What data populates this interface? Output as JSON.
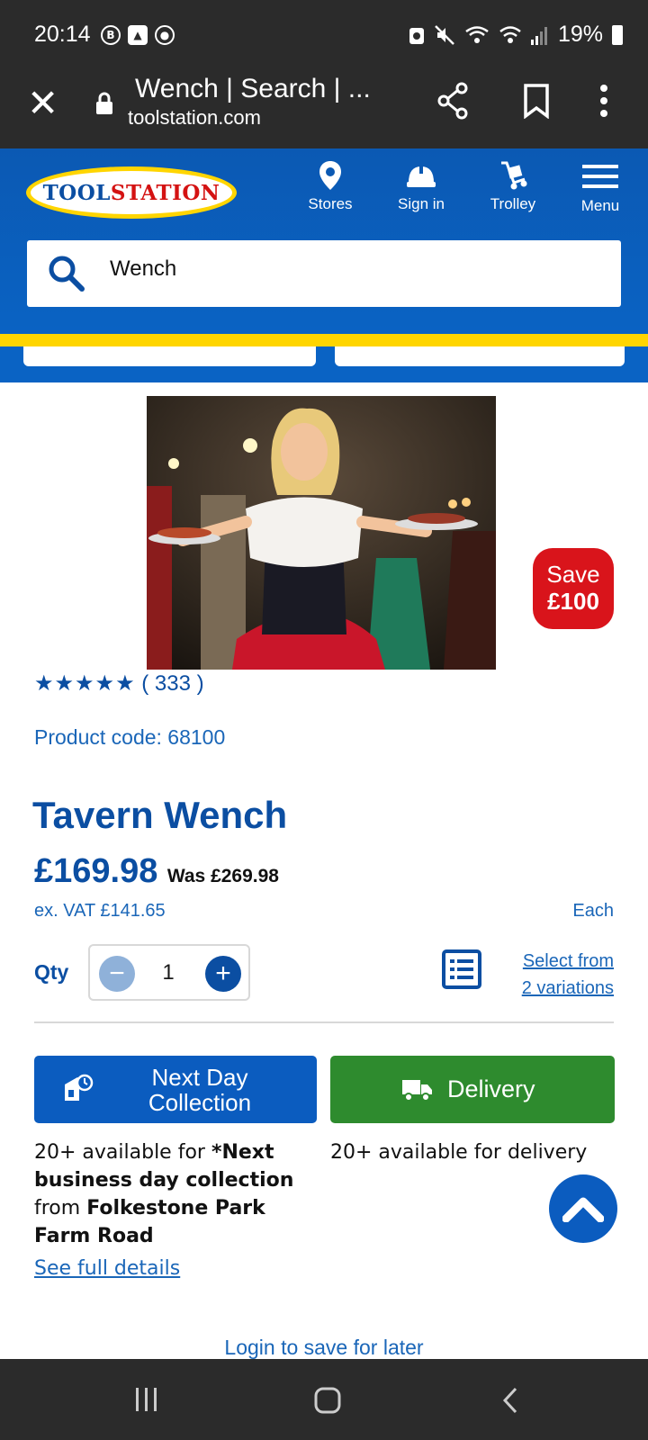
{
  "status_bar": {
    "time": "20:14",
    "battery": "19%",
    "left_icons": [
      "b-icon",
      "image-icon",
      "chrome-icon"
    ],
    "right_icons": [
      "recycle-icon",
      "mute-icon",
      "wifi-icon",
      "wifi-call-icon",
      "signal-icon",
      "battery-icon"
    ]
  },
  "browser": {
    "title": "Wench | Search | ...",
    "url": "toolstation.com"
  },
  "header": {
    "logo_text_1": "TOOL",
    "logo_text_2": "STATION",
    "nav": {
      "stores": "Stores",
      "signin": "Sign in",
      "trolley": "Trolley",
      "menu": "Menu"
    },
    "search_value": "Wench"
  },
  "product": {
    "save_line1": "Save",
    "save_line2": "£100",
    "stars": "★★★★★",
    "review_count": "( 333 )",
    "code": "Product code: 68100",
    "title": "Tavern Wench",
    "price": "£169.98",
    "was_price": "Was £269.98",
    "ex_vat": "ex. VAT £141.65",
    "unit": "Each",
    "qty_label": "Qty",
    "qty_value": "1",
    "variations_line1": "Select from",
    "variations_line2": "2 variations"
  },
  "fulfilment": {
    "collect_label_1": "Next Day",
    "collect_label_2": "Collection",
    "delivery_label": "Delivery",
    "collect_info_1": "20+ available for ",
    "collect_info_2": "*Next business day collection",
    "collect_info_3": " from ",
    "collect_info_4": "Folkestone Park Farm Road",
    "delivery_info": "20+ available for delivery",
    "see_details": "See full details",
    "login_save": "Login to save for later"
  },
  "colors": {
    "brand_blue": "#0b4ea2",
    "brand_yellow": "#ffd500",
    "save_red": "#d9141b",
    "delivery_green": "#2e8b2e"
  }
}
